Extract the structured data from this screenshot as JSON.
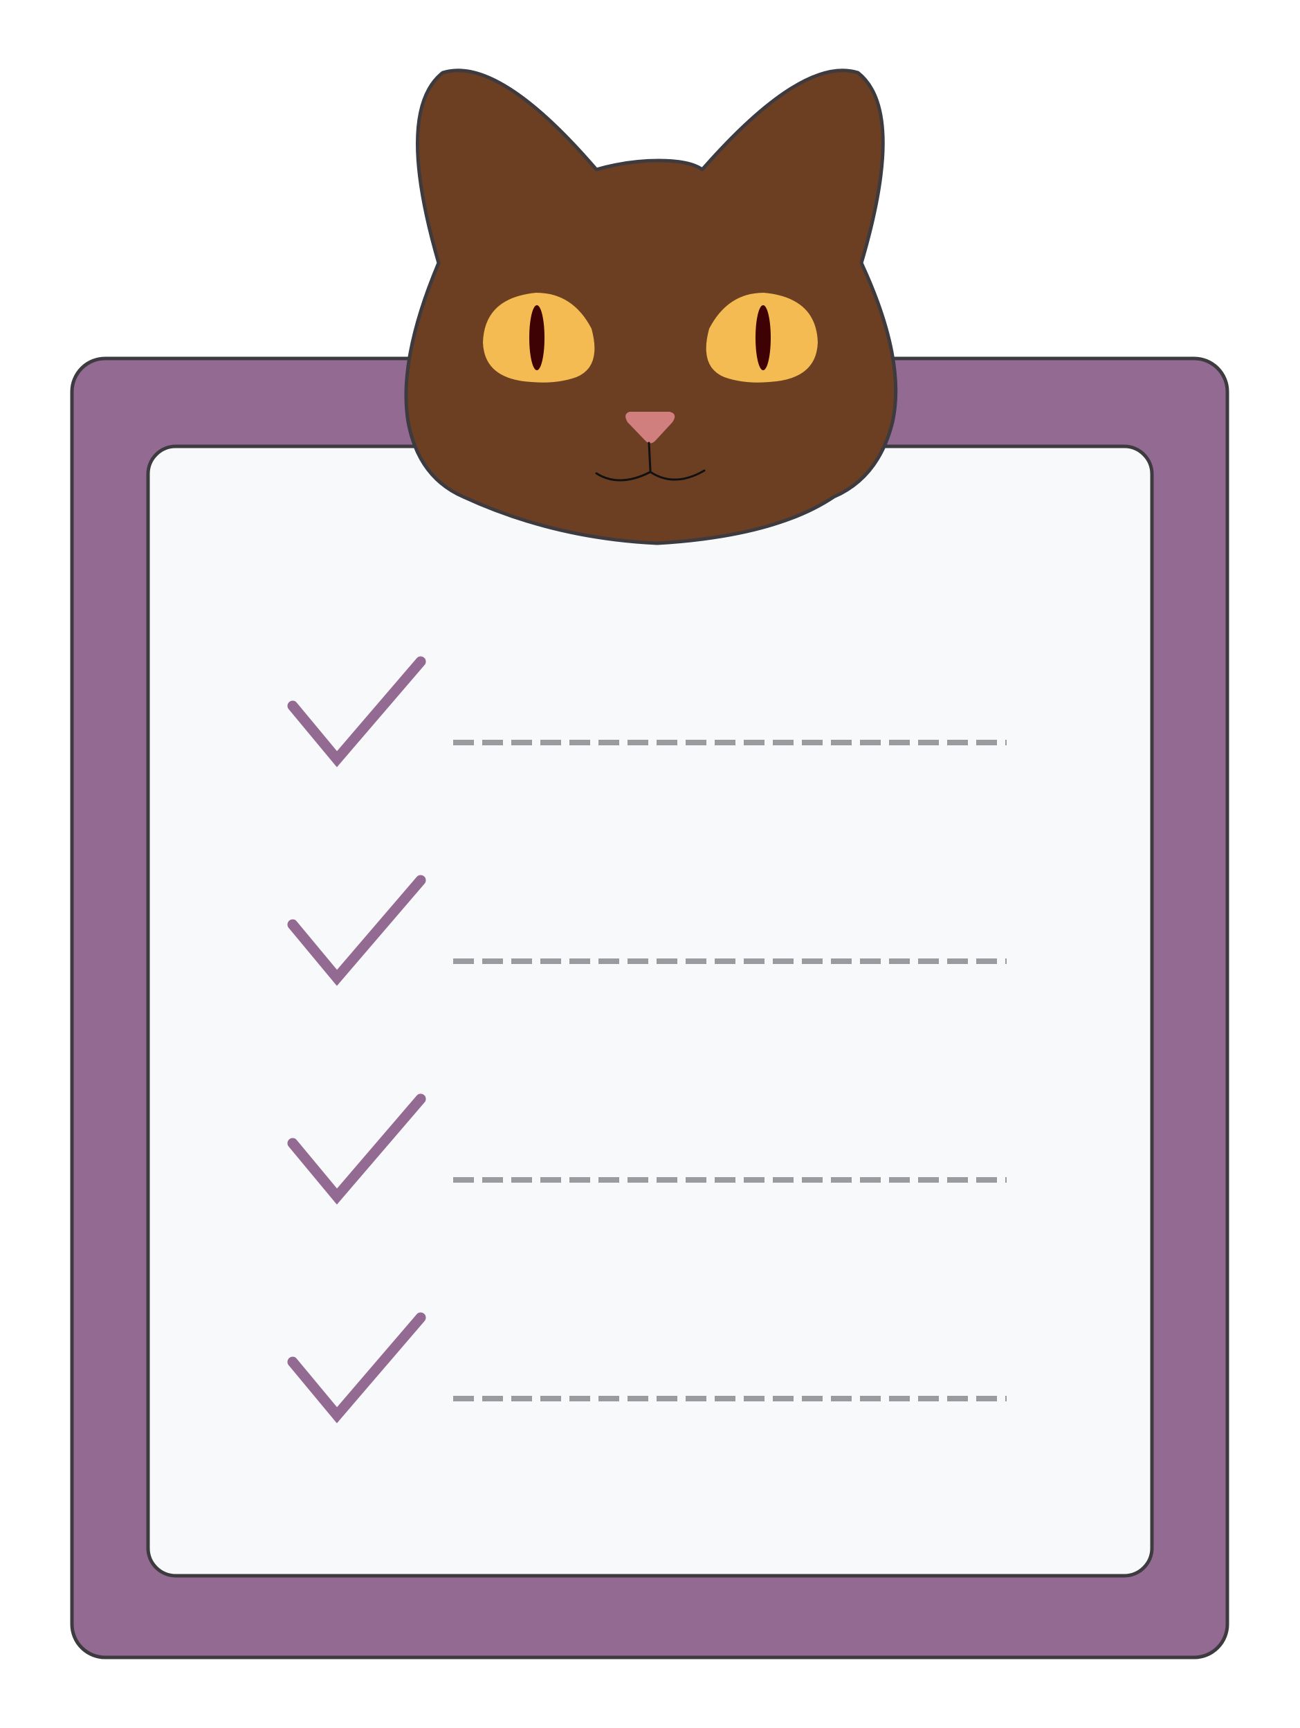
{
  "illustration": {
    "subject": "cat-checklist-clipboard",
    "colors": {
      "board": "#936a92",
      "paper": "#f8f9fb",
      "outline": "#3d3b3f",
      "cat_fur": "#6c3f22",
      "cat_eye": "#f3bb52",
      "cat_pupil": "#3f0204",
      "cat_nose": "#d17e7e",
      "check": "#936a92",
      "dash_line": "#9a9b9e"
    },
    "icons": [
      "cat-head-icon",
      "checkmark-icon"
    ],
    "checklist": {
      "items": [
        {
          "checked": true,
          "text": ""
        },
        {
          "checked": true,
          "text": ""
        },
        {
          "checked": true,
          "text": ""
        },
        {
          "checked": true,
          "text": ""
        }
      ]
    }
  }
}
